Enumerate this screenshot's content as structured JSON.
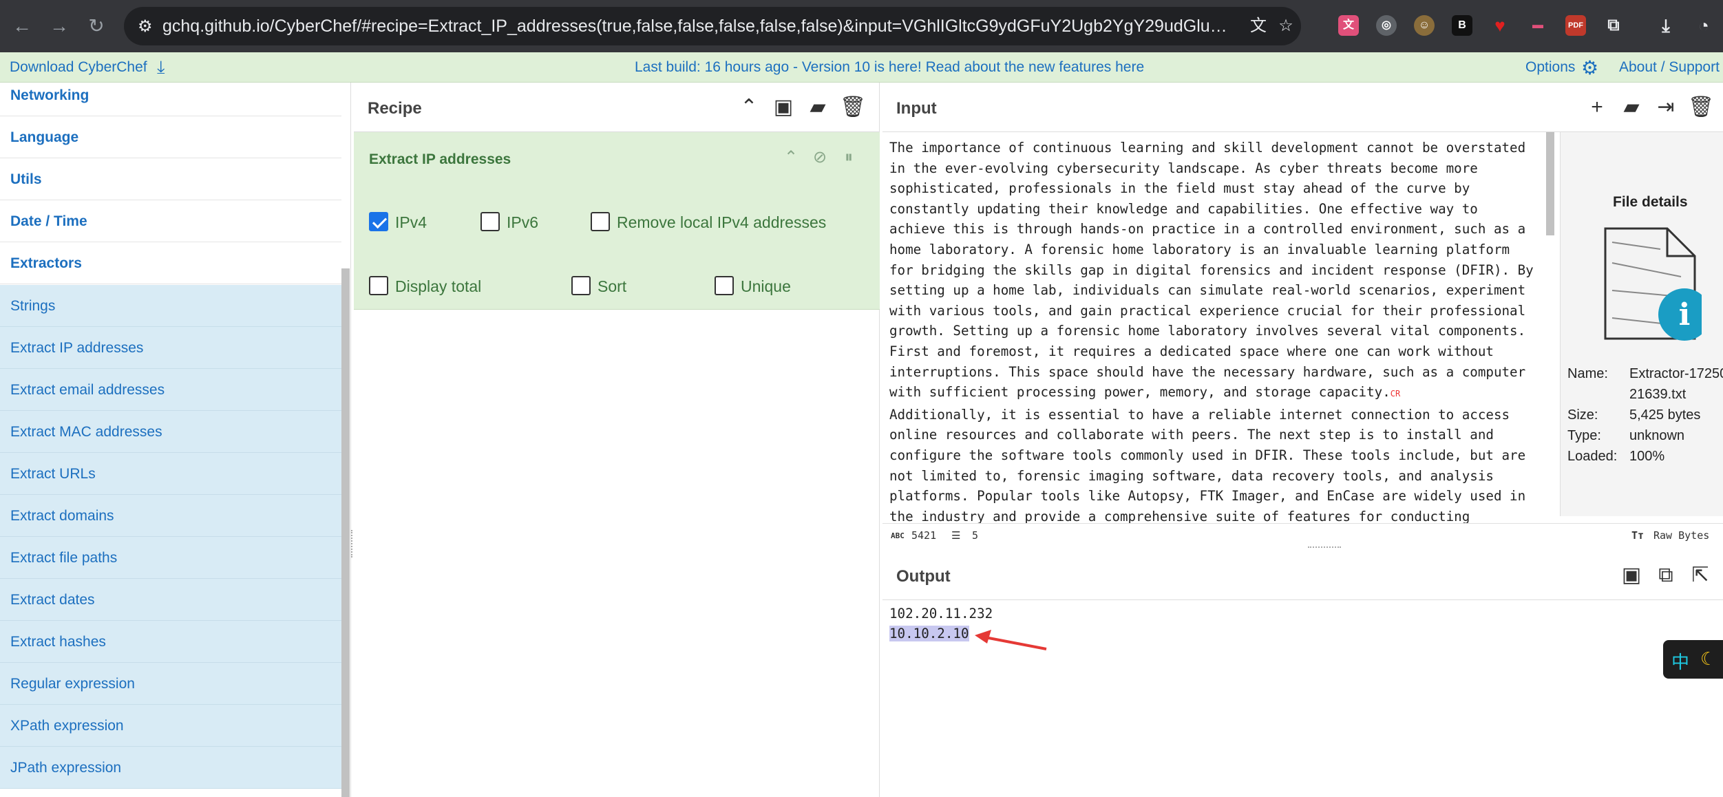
{
  "browser": {
    "url": "gchq.github.io/CyberChef/#recipe=Extract_IP_addresses(true,false,false,false,false,false)&input=VGhlIGltcG9ydGFuY2Ugb2YgY29udGludW91cyBsZWFybml...",
    "back_icon": "arrow-left-icon",
    "forward_icon": "arrow-right-icon",
    "reload_icon": "reload-icon"
  },
  "banner": {
    "download": "Download CyberChef",
    "build": "Last build: 16 hours ago - Version 10 is here! Read about the new features here",
    "options": "Options",
    "about": "About / Support"
  },
  "sidebar": {
    "categories": [
      "Networking",
      "Language",
      "Utils",
      "Date / Time",
      "Extractors"
    ],
    "operations": [
      "Strings",
      "Extract IP addresses",
      "Extract email addresses",
      "Extract MAC addresses",
      "Extract URLs",
      "Extract domains",
      "Extract file paths",
      "Extract dates",
      "Extract hashes",
      "Regular expression",
      "XPath expression",
      "JPath expression"
    ]
  },
  "recipe": {
    "title": "Recipe",
    "operation": {
      "title": "Extract IP addresses",
      "options": [
        {
          "label": "IPv4",
          "checked": true
        },
        {
          "label": "IPv6",
          "checked": false
        },
        {
          "label": "Remove local IPv4 addresses",
          "checked": false
        },
        {
          "label": "Display total",
          "checked": false
        },
        {
          "label": "Sort",
          "checked": false
        },
        {
          "label": "Unique",
          "checked": false
        }
      ]
    }
  },
  "input": {
    "title": "Input",
    "text_part1": "The importance of continuous learning and skill development cannot be overstated in the ever-evolving cybersecurity landscape. As cyber threats become more sophisticated, professionals in the field must stay ahead of the curve by constantly updating their knowledge and capabilities. One effective way to achieve this is through hands-on practice in a controlled environment, such as a home laboratory. A forensic home laboratory is an invaluable learning platform for bridging the skills gap in digital forensics and incident response (DFIR). By setting up a home lab, individuals can simulate real-world scenarios, experiment with various tools, and gain practical experience crucial for their professional growth. Setting up a forensic home laboratory involves several vital components. First and foremost, it requires a dedicated space where one can work without interruptions. This space should have the necessary hardware, such as a computer with sufficient processing power, memory, and storage capacity.",
    "cr_marker": "CR",
    "text_part2": "Additionally, it is essential to have a reliable internet connection to access online resources and collaborate with peers. The next step is to install and configure the software tools commonly used in DFIR. These tools include, but are not limited to, forensic imaging software, data recovery tools, and analysis platforms. Popular tools like Autopsy, FTK Imager, and EnCase are widely used in the industry and provide a comprehensive suite of features for conducting",
    "status": {
      "chars_label": "ABC",
      "chars": "5421",
      "lines": "5",
      "encoding": "Raw Bytes"
    }
  },
  "file_details": {
    "title": "File details",
    "name_label": "Name:",
    "name": "Extractor-17250",
    "name_cont": "21639.txt",
    "size_label": "Size:",
    "size": "5,425 bytes",
    "type_label": "Type:",
    "type": "unknown",
    "loaded_label": "Loaded:",
    "loaded": "100%"
  },
  "output": {
    "title": "Output",
    "lines": [
      "102.20.11.232",
      "10.10.2.10"
    ]
  },
  "ime": {
    "lang": "中",
    "moon": "☾"
  },
  "colors": {
    "accent": "#1c6fbf",
    "recipe_bg": "#dff0d8",
    "ops_bg": "#d8ebf5"
  }
}
